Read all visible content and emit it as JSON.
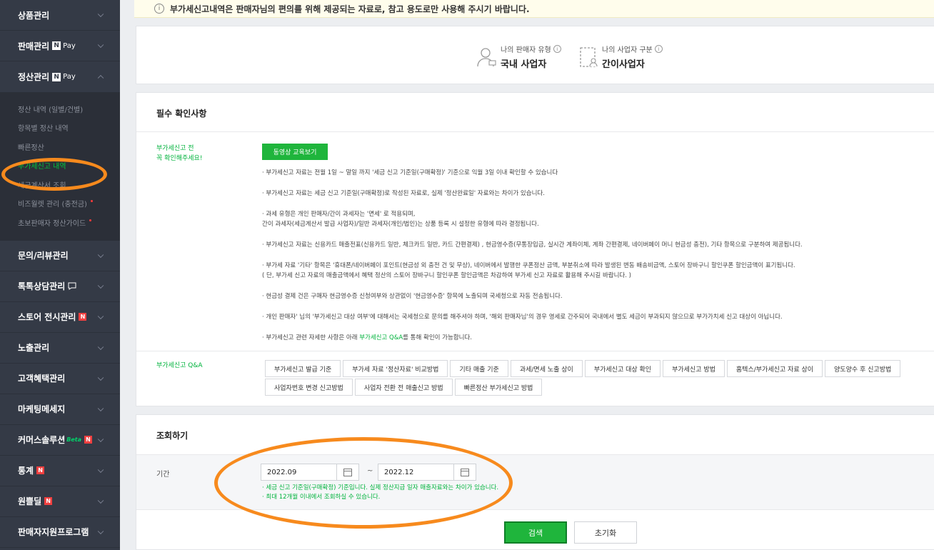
{
  "sidebar": {
    "items_top": [
      {
        "label": "상품관리"
      },
      {
        "label": "판매관리",
        "npay": true
      },
      {
        "label": "정산관리",
        "npay": true,
        "expanded": true
      }
    ],
    "npay_n": "N",
    "npay_pay": "Pay",
    "submenu": [
      {
        "label": "정산 내역 (일별/건별)"
      },
      {
        "label": "항목별 정산 내역"
      },
      {
        "label": "빠른정산"
      },
      {
        "label": "부가세신고 내역",
        "active": true
      },
      {
        "label": "세금계산서 조회"
      },
      {
        "label": "비즈월렛 관리 (충전금)",
        "dot": true
      },
      {
        "label": "초보판매자 정산가이드",
        "dot": true
      }
    ],
    "items_bottom": [
      {
        "label": "문의/리뷰관리"
      },
      {
        "label": "톡톡상담관리"
      },
      {
        "label": "스토어 전시관리",
        "badge": "N"
      },
      {
        "label": "노출관리"
      },
      {
        "label": "고객혜택관리"
      },
      {
        "label": "마케팅메세지"
      },
      {
        "label": "커머스솔루션",
        "beta": "Beta",
        "badge": "N"
      },
      {
        "label": "통계",
        "badge": "N"
      },
      {
        "label": "원쁠딜",
        "badge": "N"
      },
      {
        "label": "판매자지원프로그램"
      }
    ]
  },
  "notice": {
    "icon": "i",
    "text": "부가세신고내역은 판매자님의 편의를 위해 제공되는 자료로, 참고 용도로만 사용해 주시기 바랍니다."
  },
  "seller": {
    "type_label": "나의 판매자 유형",
    "type_value": "국내 사업자",
    "biz_label": "나의 사업자 구분",
    "biz_value": "간이사업자",
    "info_glyph": "i"
  },
  "confirm": {
    "title": "필수 확인사항",
    "label_line1": "부가세신고 전",
    "label_line2": "꼭 확인해주세요!",
    "video_button": "동영상 교육보기",
    "bullets": [
      "· 부가세신고 자료는 전월 1일 ~ 말일 까지 '세금 신고 기준일(구매확정)' 기준으로 익월 3일 이내 확인할 수 있습니다",
      "· 부가세신고 자료는 세금 신고 기준일(구매확정)로 작성된 자료로, 실제 '정산완료일' 자료와는 차이가 있습니다.",
      "· 과세 유형은 개인 판매자/간이 과세자는 '면세' 로 적용되며,\n간이 과세자(세금계산서 발급 사업자)/일반 과세자(개인/법인)는 상품 등록 시 설정한 유형에 따라 결정됩니다.",
      "· 부가세신고 자료는 신용카드 매출전표(신용카드 일반, 체크카드 일반, 카드 간편결제) , 현금영수증(무통장입금, 실시간 계좌이체, 계좌 간편결제, 네이버페이 머니 현금성 충전), 기타 항목으로 구분하여 제공됩니다.",
      "· 부가세 자료 '기타' 항목은 '휴대폰/네이버페이 포인트(현금성 외 충전 건 및 무상), 네이버에서 발행한 쿠폰정산 금액, 부분취소에 따라 발생된 변동 배송비금액, 스토어 장바구니 할인쿠폰 할인금액이 표기됩니다.\n( 단, 부가세 신고 자료의 매출금액에서 혜택 정산의 스토어 장바구니 할인쿠폰 할인금액은 차감하여 부가세 신고 자료로 활용해 주시길 바랍니다. )",
      "· 현금성 결제 건은 구매자 현금영수증 신청여부와 상관없이 '현금영수증' 항목에 노출되며 국세청으로 자동 전송됩니다.",
      "· 개인 판매자' 님의 '부가세신고 대상 여부'에 대해서는 국세청으로 문의를 해주셔야 하며, '해외 판매자님'의 경우 영세로 간주되어 국내에서 별도 세금이 부과되지 않으므로 부가가치세 신고 대상이 아닙니다."
    ],
    "last_prefix": "· 부가세신고 관련 자세한 사항은 아래 ",
    "last_link": "부가세신고 Q&A",
    "last_suffix": "를 통해 확인이 가능합니다.",
    "qa_label": "부가세신고 Q&A",
    "qa_buttons": [
      "부가세신고 발급 기준",
      "부가세 자료 '정산자료' 비교방법",
      "기타 매출 기준",
      "과세/면세 노출 상이",
      "부가세신고 대상 확인",
      "부가세신고 방법",
      "홈텍스/부가세신고 자료 상이",
      "양도양수 후 신고방법",
      "사업자번호 변경 신고방법",
      "사업자 전환 전 매출신고 방법",
      "빠른정산 부가세신고 방법"
    ]
  },
  "search": {
    "title": "조회하기",
    "period_label": "기간",
    "date_from": "2022.09",
    "date_to": "2022.12",
    "tilde": "~",
    "hint1": "· 세금 신고 기준일(구매확정) 기준입니다. 실제 정산지급 일자 매출자료와는 차이가 있습니다.",
    "hint2": "· 최대 12개월 이내에서 조회하실 수 있습니다.",
    "search_button": "검색",
    "reset_button": "초기화"
  },
  "colors": {
    "sidebar_bg": "#343a46",
    "accent_green": "#1fb53c",
    "annotation_orange": "#f78a1d"
  }
}
